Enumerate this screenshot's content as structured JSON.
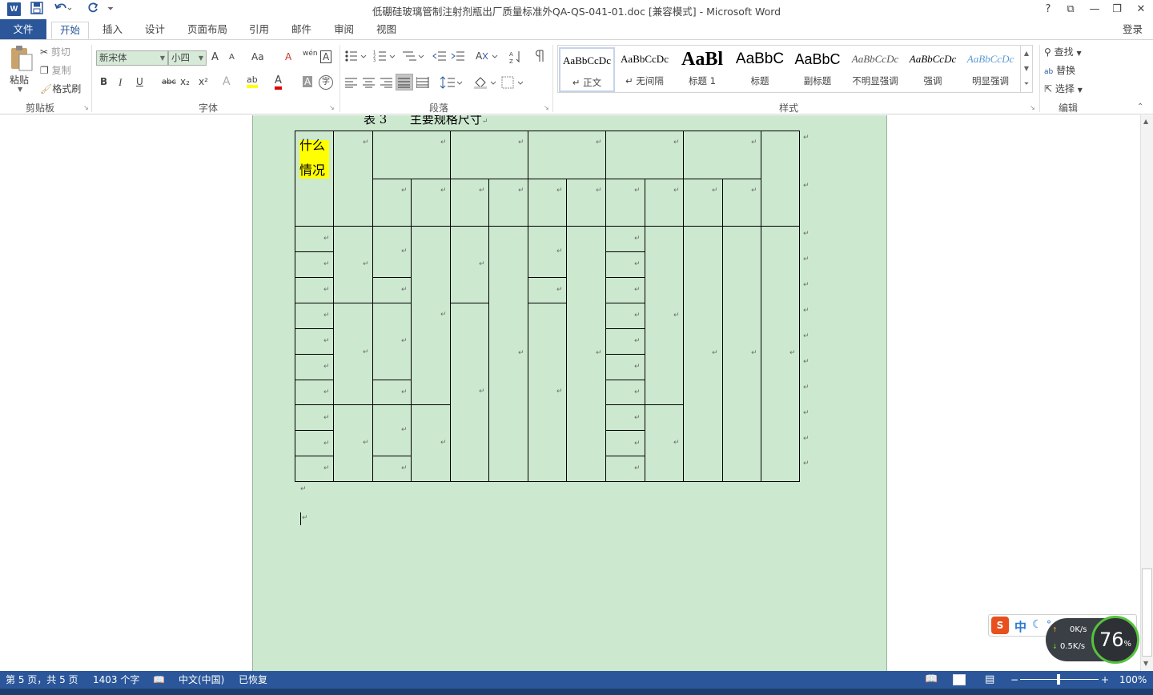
{
  "window": {
    "title": "低硼硅玻璃管制注射剂瓶出厂质量标准外QA-QS-041-01.doc [兼容模式] - Microsoft Word",
    "app_icon": "W",
    "quick_access": {
      "save_icon": "save-icon",
      "undo_icon": "undo-icon",
      "redo_icon": "redo-icon",
      "customize_icon": "customize-icon"
    },
    "controls": {
      "help": "?",
      "ribbon_display": "⧉",
      "restore": "❐",
      "close": "✕"
    }
  },
  "tabs": {
    "file": "文件",
    "items": [
      "开始",
      "插入",
      "设计",
      "页面布局",
      "引用",
      "邮件",
      "审阅",
      "视图"
    ],
    "active": "开始",
    "login": "登录"
  },
  "ribbon": {
    "clipboard": {
      "paste": "粘贴",
      "cut": "剪切",
      "copy": "复制",
      "format_painter": "格式刷",
      "label": "剪贴板"
    },
    "font": {
      "name": "新宋体",
      "size": "小四",
      "label": "字体",
      "bold": "B",
      "italic": "I",
      "underline": "U",
      "strike": "abc",
      "subscript": "x₂",
      "superscript": "x²",
      "grow": "A",
      "shrink": "A",
      "case": "Aa",
      "clear": "A",
      "phonetic": "wén",
      "border_char": "A",
      "effects": "A",
      "highlight": "ab",
      "font_color": "A",
      "shade": "A",
      "enclose": "字"
    },
    "paragraph": {
      "label": "段落"
    },
    "styles": {
      "label": "样式",
      "items": [
        {
          "sample": "AaBbCcDc",
          "name": "正文",
          "mark": "↵"
        },
        {
          "sample": "AaBbCcDc",
          "name": "无间隔",
          "mark": "↵"
        },
        {
          "sample": "AaBl",
          "name": "标题 1"
        },
        {
          "sample": "AaBbC",
          "name": "标题"
        },
        {
          "sample": "AaBbC",
          "name": "副标题"
        },
        {
          "sample": "AaBbCcDc",
          "name": "不明显强调"
        },
        {
          "sample": "AaBbCcDc",
          "name": "强调"
        },
        {
          "sample": "AaBbCcDc",
          "name": "明显强调"
        }
      ]
    },
    "editing": {
      "find": "查找",
      "replace": "替换",
      "select": "选择",
      "label": "编辑"
    }
  },
  "document": {
    "caption": "表 3      主要规格尺寸",
    "caption_mark": "↵",
    "highlight_text": [
      "什么",
      "情况"
    ],
    "paragraph_mark": "↵",
    "highlight_color": "#ffff00"
  },
  "status": {
    "page": "第 5 页，共 5 页",
    "words": "1403 个字",
    "language": "中文(中国)",
    "recovered": "已恢复",
    "zoom": "100%",
    "zoom_minus": "−",
    "zoom_plus": "+"
  },
  "overlay": {
    "ime_lang": "中",
    "up_speed": "0K/s",
    "down_speed": "0.5K/s",
    "percent": "76",
    "percent_sign": "%"
  },
  "colors": {
    "accent": "#2b579a",
    "page_bg": "#cce8cf",
    "highlight": "#ffff00"
  }
}
